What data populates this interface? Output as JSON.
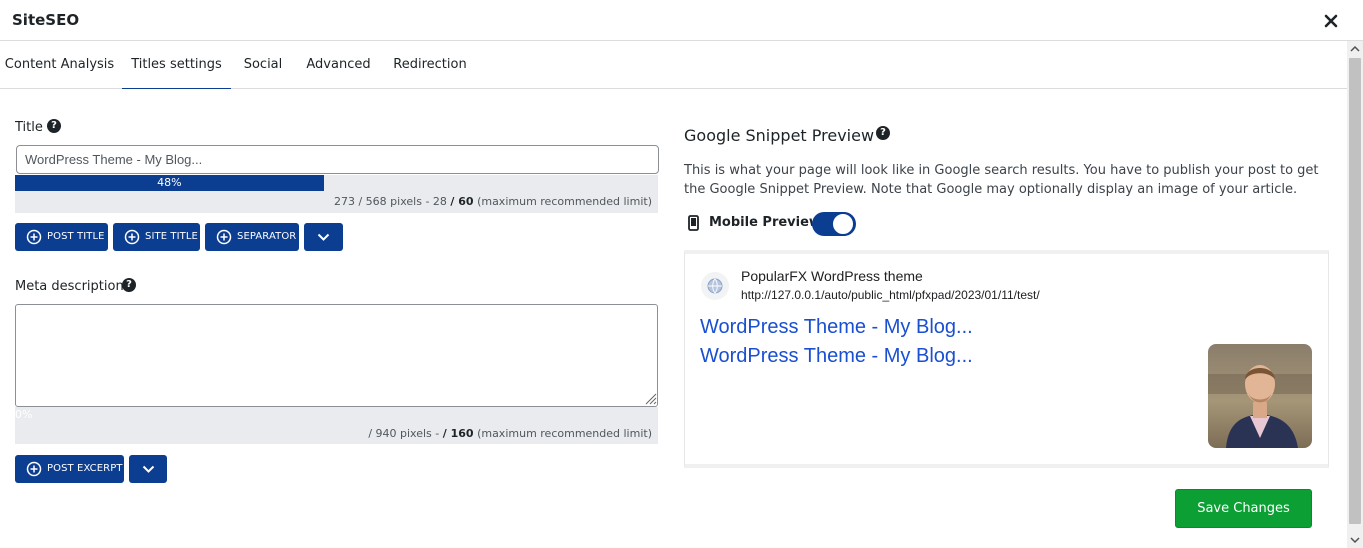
{
  "app": {
    "title": "SiteSEO"
  },
  "tabs": [
    {
      "label": "Content Analysis"
    },
    {
      "label": "Titles settings",
      "active": true
    },
    {
      "label": "Social"
    },
    {
      "label": "Advanced"
    },
    {
      "label": "Redirection"
    }
  ],
  "title_field": {
    "label": "Title",
    "value": "WordPress Theme - My Blog...",
    "meter_percent": 48,
    "meter_label": "48%",
    "pixels_used": "273",
    "pixels_text": "/ 568 pixels - 28",
    "chars_limit": "/ 60",
    "limit_note": "(maximum recommended limit)"
  },
  "title_tags": [
    {
      "label": "POST TITLE"
    },
    {
      "label": "SITE TITLE"
    },
    {
      "label": "SEPARATOR"
    }
  ],
  "meta_field": {
    "label": "Meta description",
    "value": "",
    "meter_percent": 0,
    "meter_label": "0%",
    "pixels_text": "/ 940 pixels -",
    "chars_limit": "/ 160",
    "limit_note": "(maximum recommended limit)"
  },
  "meta_tags": [
    {
      "label": "POST EXCERPT"
    }
  ],
  "snippet": {
    "heading": "Google Snippet Preview",
    "description": "This is what your page will look like in Google search results. You have to publish your post to get the Google Snippet Preview. Note that Google may optionally display an image of your article.",
    "mobile_label": "Mobile Preview",
    "mobile_on": true,
    "site_name": "PopularFX WordPress theme",
    "site_url": "http://127.0.0.1/auto/public_html/pfxpad/2023/01/11/test/",
    "serp_title": "WordPress Theme - My Blog...",
    "serp_desc": "WordPress Theme - My Blog..."
  },
  "save_label": "Save Changes",
  "colors": {
    "primary": "#0b3d91",
    "save": "#0b9f34",
    "link": "#1a4fd1"
  }
}
